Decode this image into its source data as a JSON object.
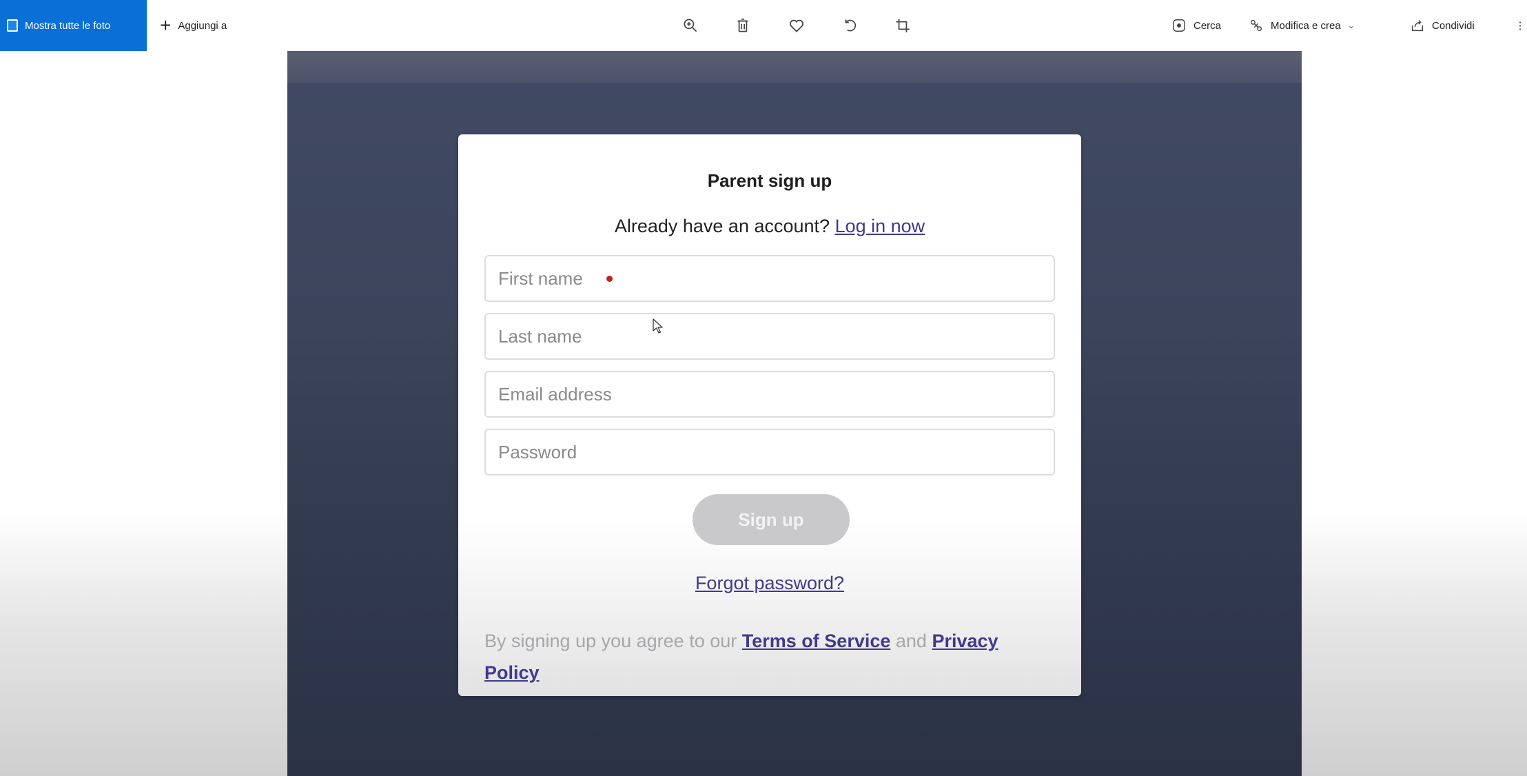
{
  "toolbar": {
    "show_all_photos": "Mostra tutte le foto",
    "add_to": "Aggiungi a",
    "search": "Cerca",
    "edit_create": "Modifica e crea",
    "share": "Condividi",
    "more": "⋮"
  },
  "form": {
    "title": "Parent sign up",
    "already_have_account": "Already have an account?",
    "login_link": "Log in now",
    "first_name_placeholder": "First name",
    "last_name_placeholder": "Last name",
    "email_placeholder": "Email address",
    "password_placeholder": "Password",
    "signup_button": "Sign up",
    "forgot_password": "Forgot password?",
    "legal_prefix": "By signing up you agree to our",
    "terms_link": "Terms of Service",
    "legal_and": "and",
    "privacy_link_1": "Privacy",
    "privacy_link_2": "Policy"
  },
  "colors": {
    "accent": "#0a6fd6",
    "link": "#3f3a8c",
    "required": "#c62020"
  }
}
